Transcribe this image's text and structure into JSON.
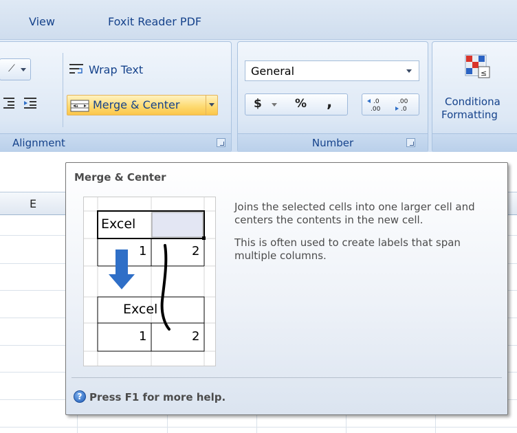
{
  "ribbon": {
    "tabs": [
      "View",
      "Foxit Reader PDF"
    ],
    "alignment": {
      "wrap_text_label": "Wrap Text",
      "merge_center_label": "Merge & Center",
      "group_label": "Alignment"
    },
    "number": {
      "format_value": "General",
      "currency_symbol": "$",
      "percent_symbol": "%",
      "comma_symbol": ",",
      "group_label": "Number"
    },
    "styles": {
      "conditional_formatting_line1": "Conditiona",
      "conditional_formatting_line2": "Formatting"
    }
  },
  "sheet": {
    "column_header_e": "E"
  },
  "tooltip": {
    "title": "Merge & Center",
    "description_1": "Joins the selected cells into one larger cell and centers the contents in the new cell.",
    "description_2": "This is often used to create labels that span multiple columns.",
    "help_text": "Press F1 for more help.",
    "illustration": {
      "top_cell_text": "Excel",
      "top_row_values": [
        "1",
        "2"
      ],
      "merged_cell_text": "Excel",
      "bottom_row_values": [
        "1",
        "2"
      ]
    }
  },
  "colors": {
    "ribbon_text": "#15428b",
    "merge_highlight": "#fdd96e",
    "arrow_blue": "#2f6fc7"
  }
}
